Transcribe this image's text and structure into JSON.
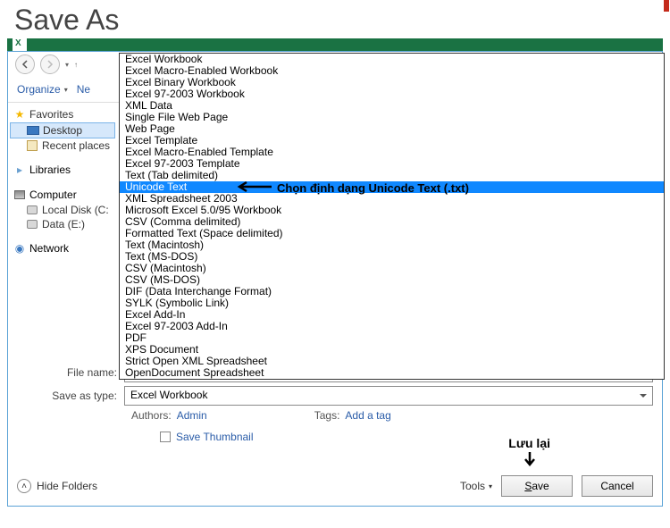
{
  "title": "Save As",
  "toolbar": {
    "organize": "Organize",
    "new_btn_partial": "Ne"
  },
  "tree": {
    "favorites": "Favorites",
    "desktop": "Desktop",
    "recent_places": "Recent places",
    "libraries": "Libraries",
    "computer": "Computer",
    "local_disk": "Local Disk (C:",
    "data_e": "Data (E:)",
    "network": "Network"
  },
  "dropdown_items": [
    "Excel Workbook",
    "Excel Macro-Enabled Workbook",
    "Excel Binary Workbook",
    "Excel 97-2003 Workbook",
    "XML Data",
    "Single File Web Page",
    "Web Page",
    "Excel Template",
    "Excel Macro-Enabled Template",
    "Excel 97-2003 Template",
    "Text (Tab delimited)",
    "Unicode Text",
    "XML Spreadsheet 2003",
    "Microsoft Excel 5.0/95 Workbook",
    "CSV (Comma delimited)",
    "Formatted Text (Space delimited)",
    "Text (Macintosh)",
    "Text (MS-DOS)",
    "CSV (Macintosh)",
    "CSV (MS-DOS)",
    "DIF (Data Interchange Format)",
    "SYLK (Symbolic Link)",
    "Excel Add-In",
    "Excel 97-2003 Add-In",
    "PDF",
    "XPS Document",
    "Strict Open XML Spreadsheet",
    "OpenDocument Spreadsheet"
  ],
  "highlight_index": 11,
  "fields": {
    "file_name_label": "File name:",
    "save_type_label": "Save as type:",
    "save_type_value": "Excel Workbook",
    "authors_label": "Authors:",
    "authors_value": "Admin",
    "tags_label": "Tags:",
    "tags_value": "Add a tag",
    "save_thumb": "Save Thumbnail"
  },
  "bottom": {
    "hide_folders": "Hide Folders",
    "tools": "Tools",
    "save": "Save",
    "cancel": "Cancel"
  },
  "annotations": {
    "choose_format": "Chọn định dạng Unicode Text (.txt)",
    "save_again": "Lưu lại"
  }
}
